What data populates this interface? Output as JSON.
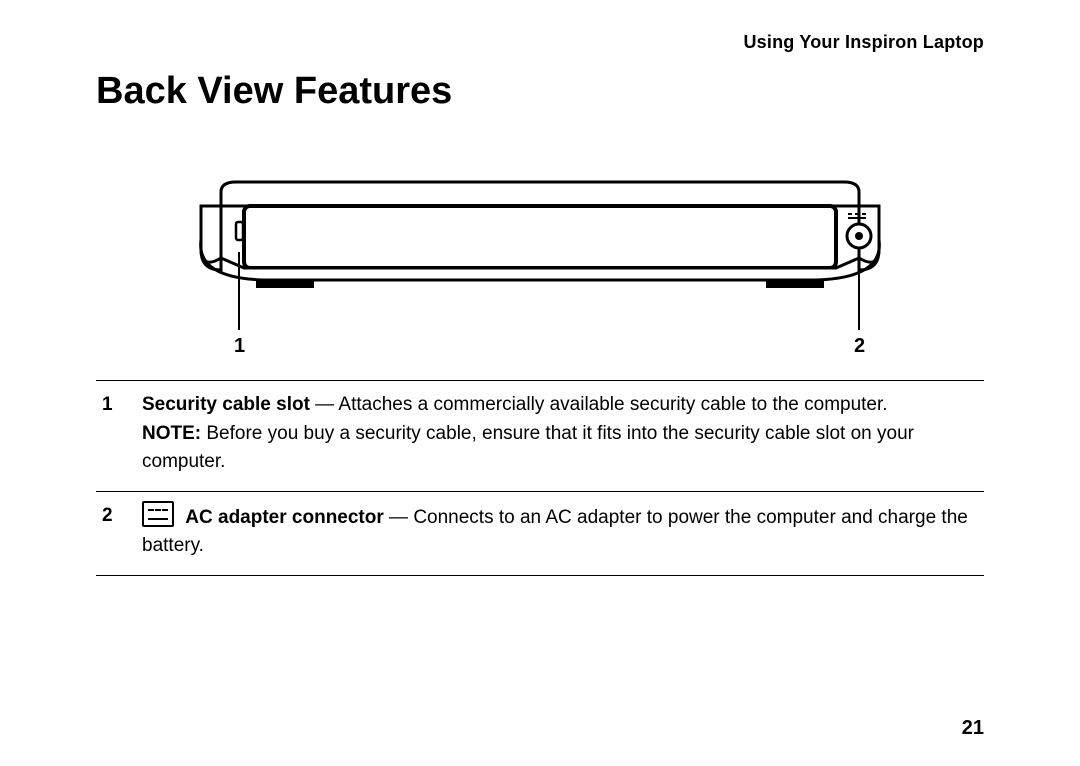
{
  "running_header": "Using Your Inspiron Laptop",
  "title": "Back View Features",
  "callouts": {
    "c1": "1",
    "c2": "2"
  },
  "features": [
    {
      "num": "1",
      "term": "Security cable slot",
      "desc": " — Attaches a commercially available security cable to the computer.",
      "note_label": "NOTE:",
      "note_text": " Before you buy a security cable, ensure that it fits into the security cable slot on your computer."
    },
    {
      "num": "2",
      "term": "AC adapter connector",
      "desc": " — Connects to an AC adapter to power the computer and charge the battery."
    }
  ],
  "page_number": "21"
}
